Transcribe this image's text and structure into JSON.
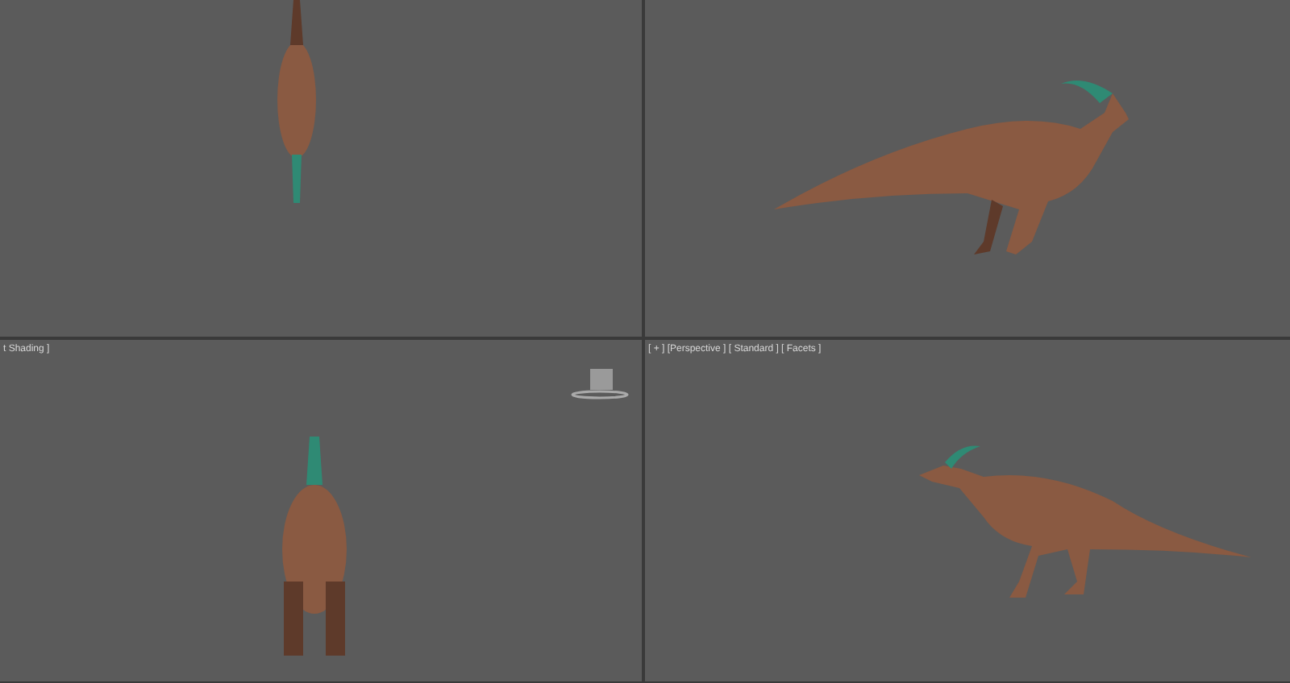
{
  "viewports": [
    {
      "kind": "top"
    },
    {
      "kind": "left"
    },
    {
      "kind": "front",
      "label": "t Shading ]"
    },
    {
      "kind": "perspective",
      "label": "[ + ] [Perspective ] [ Standard ] [ Facets ]"
    }
  ]
}
